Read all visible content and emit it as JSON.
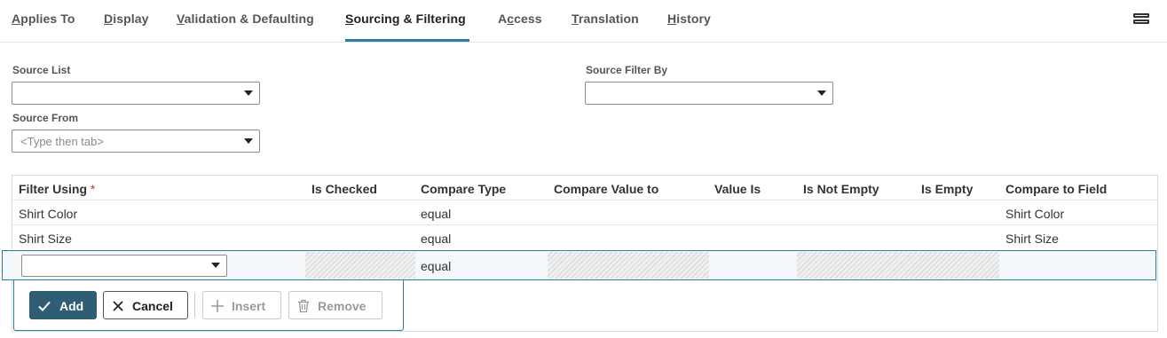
{
  "tabs": [
    {
      "pre": "",
      "key": "A",
      "post": "pplies To",
      "active": false
    },
    {
      "pre": "",
      "key": "D",
      "post": "isplay",
      "active": false
    },
    {
      "pre": "",
      "key": "V",
      "post": "alidation & Defaulting",
      "active": false
    },
    {
      "pre": "",
      "key": "S",
      "post": "ourcing & Filtering",
      "active": true
    },
    {
      "pre": "A",
      "key": "c",
      "post": "cess",
      "active": false
    },
    {
      "pre": "",
      "key": "T",
      "post": "ranslation",
      "active": false
    },
    {
      "pre": "",
      "key": "H",
      "post": "istory",
      "active": false
    }
  ],
  "icons": {
    "menu": "stacked-menu-icon",
    "dropdown": "caret-down-icon",
    "add": "check-icon",
    "cancel": "x-icon",
    "insert": "plus-icon",
    "remove": "trash-icon"
  },
  "form": {
    "source_list": {
      "label": "Source List",
      "value": ""
    },
    "source_filter_by": {
      "label": "Source Filter By",
      "value": ""
    },
    "source_from": {
      "label": "Source From",
      "placeholder": "<Type then tab>"
    }
  },
  "grid": {
    "headers": [
      "Filter Using",
      "Is Checked",
      "Compare Type",
      "Compare Value to",
      "Value Is",
      "Is Not Empty",
      "Is Empty",
      "Compare to Field"
    ],
    "required_mark": "*",
    "rows": [
      [
        "Shirt Color",
        "",
        "equal",
        "",
        "",
        "",
        "",
        "Shirt Color"
      ],
      [
        "Shirt Size",
        "",
        "equal",
        "",
        "",
        "",
        "",
        "Shirt Size"
      ]
    ],
    "edit_row": {
      "filter_using": "",
      "compare_type": "equal"
    }
  },
  "buttons": {
    "add": "Add",
    "cancel": "Cancel",
    "insert": "Insert",
    "remove": "Remove"
  },
  "colors": {
    "accent": "#2e7da3",
    "primary_button": "#2f5d73",
    "required": "#c0392b"
  }
}
